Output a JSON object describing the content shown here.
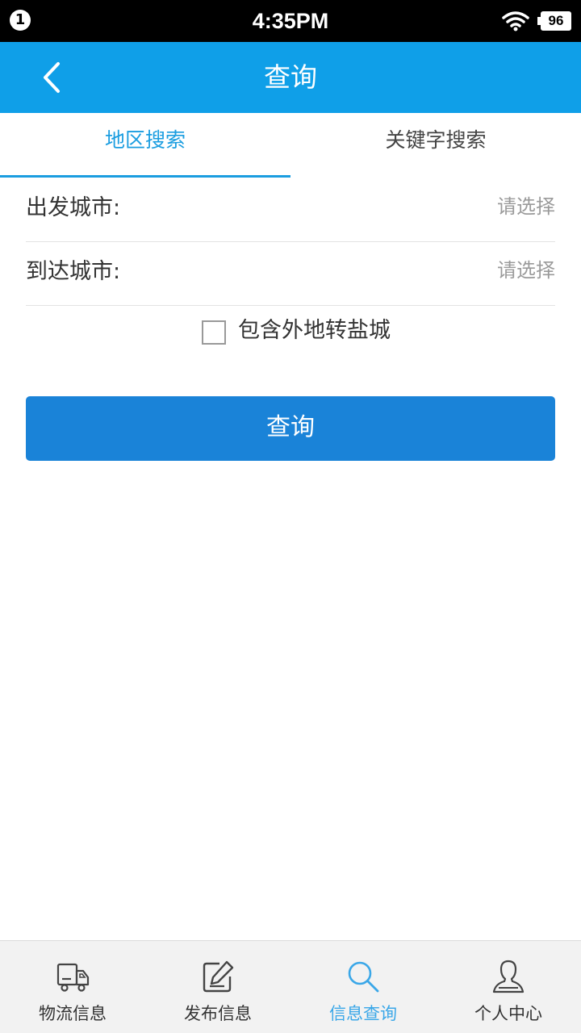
{
  "status_bar": {
    "notification_count": "1",
    "time": "4:35PM",
    "battery": "96"
  },
  "header": {
    "title": "查询",
    "back_icon": "chevron-left-icon"
  },
  "tabs": [
    {
      "label": "地区搜索",
      "active": true
    },
    {
      "label": "关键字搜索",
      "active": false
    }
  ],
  "form": {
    "departure_label": "出发城市:",
    "departure_value": "请选择",
    "arrival_label": "到达城市:",
    "arrival_value": "请选择",
    "checkbox_label": "包含外地转盐城",
    "checkbox_checked": false,
    "submit_label": "查询"
  },
  "bottom_nav": [
    {
      "label": "物流信息",
      "icon": "truck-icon",
      "active": false
    },
    {
      "label": "发布信息",
      "icon": "edit-icon",
      "active": false
    },
    {
      "label": "信息查询",
      "icon": "search-icon",
      "active": true
    },
    {
      "label": "个人中心",
      "icon": "user-icon",
      "active": false
    }
  ],
  "colors": {
    "header_bg": "#0f9fe8",
    "accent": "#1a9de0",
    "button_bg": "#1a83d8",
    "nav_active": "#3aa7e8"
  }
}
